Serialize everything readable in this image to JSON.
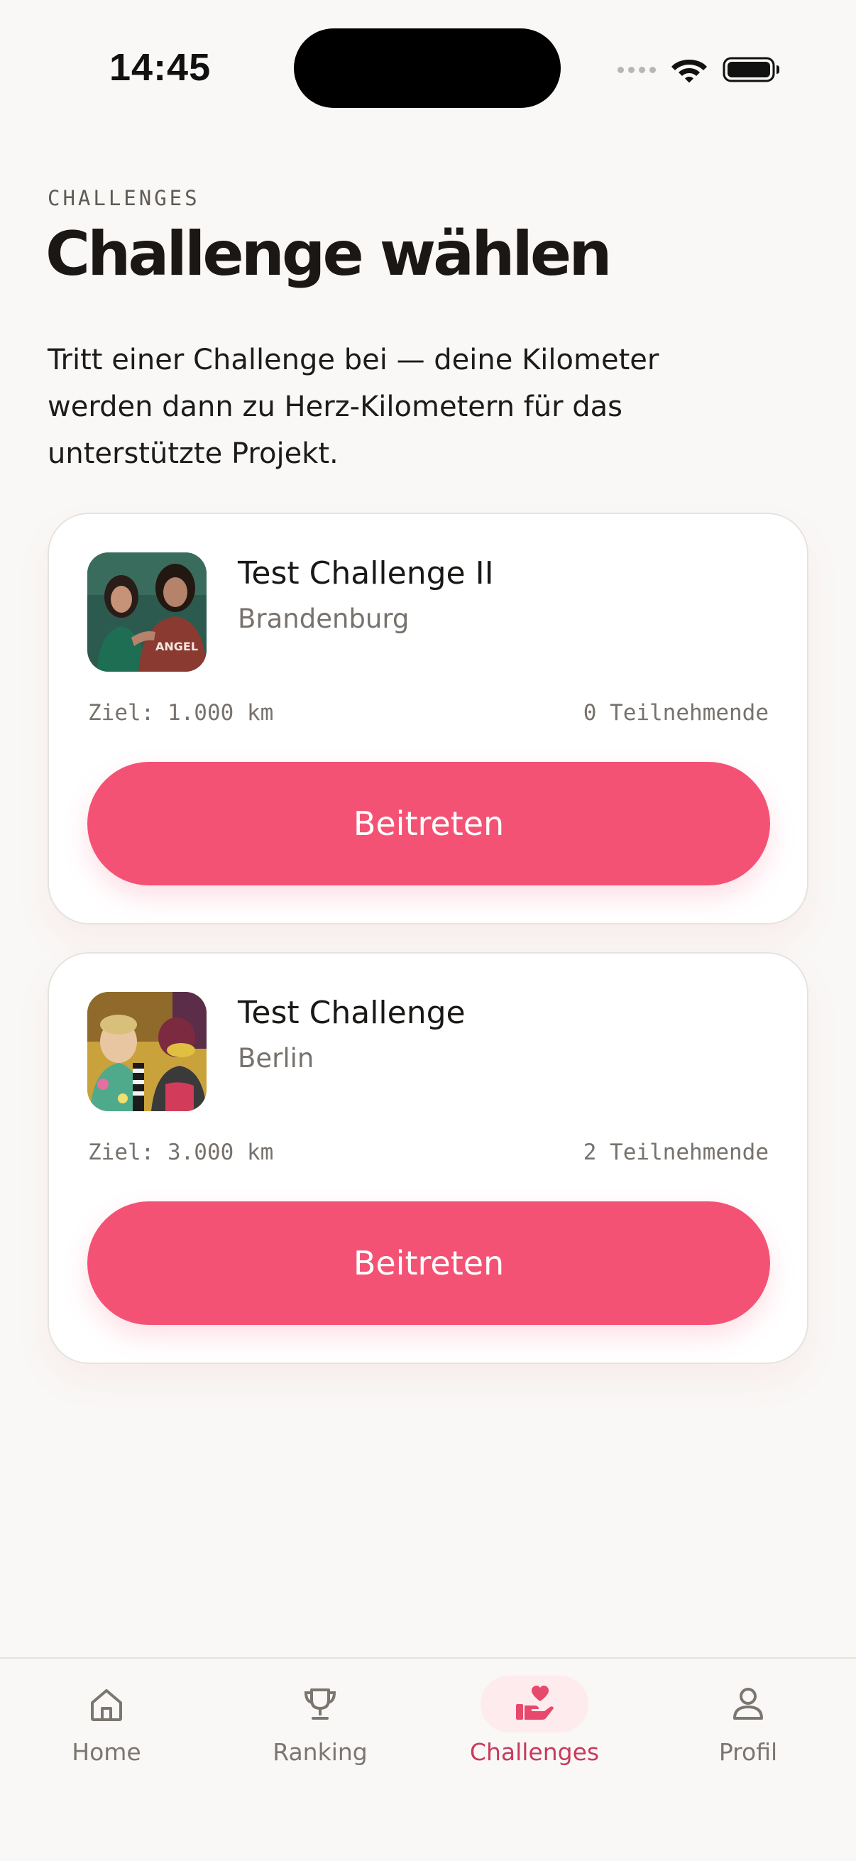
{
  "status_bar": {
    "time": "14:45"
  },
  "header": {
    "overline": "CHALLENGES",
    "title": "Challenge wählen",
    "intro": "Tritt einer Challenge bei — deine Kilometer werden dann zu Herz-Kilometern für das unterstützte Projekt."
  },
  "challenges": [
    {
      "name": "Test Challenge II",
      "region": "Brandenburg",
      "goal": "Ziel: 1.000 km",
      "participants": "0 Teilnehmende",
      "button": "Beitreten"
    },
    {
      "name": "Test Challenge",
      "region": "Berlin",
      "goal": "Ziel: 3.000 km",
      "participants": "2 Teilnehmende",
      "button": "Beitreten"
    }
  ],
  "tab_bar": {
    "items": [
      {
        "label": "Home",
        "icon": "home-icon",
        "active": false
      },
      {
        "label": "Ranking",
        "icon": "trophy-icon",
        "active": false
      },
      {
        "label": "Challenges",
        "icon": "heart-hand-icon",
        "active": true
      },
      {
        "label": "Profil",
        "icon": "person-icon",
        "active": false
      }
    ]
  },
  "colors": {
    "background": "#f9f8f6",
    "accent": "#f45274",
    "accent_dark": "#c93a5c",
    "accent_soft": "#fdebed",
    "muted_text": "#77726d"
  }
}
